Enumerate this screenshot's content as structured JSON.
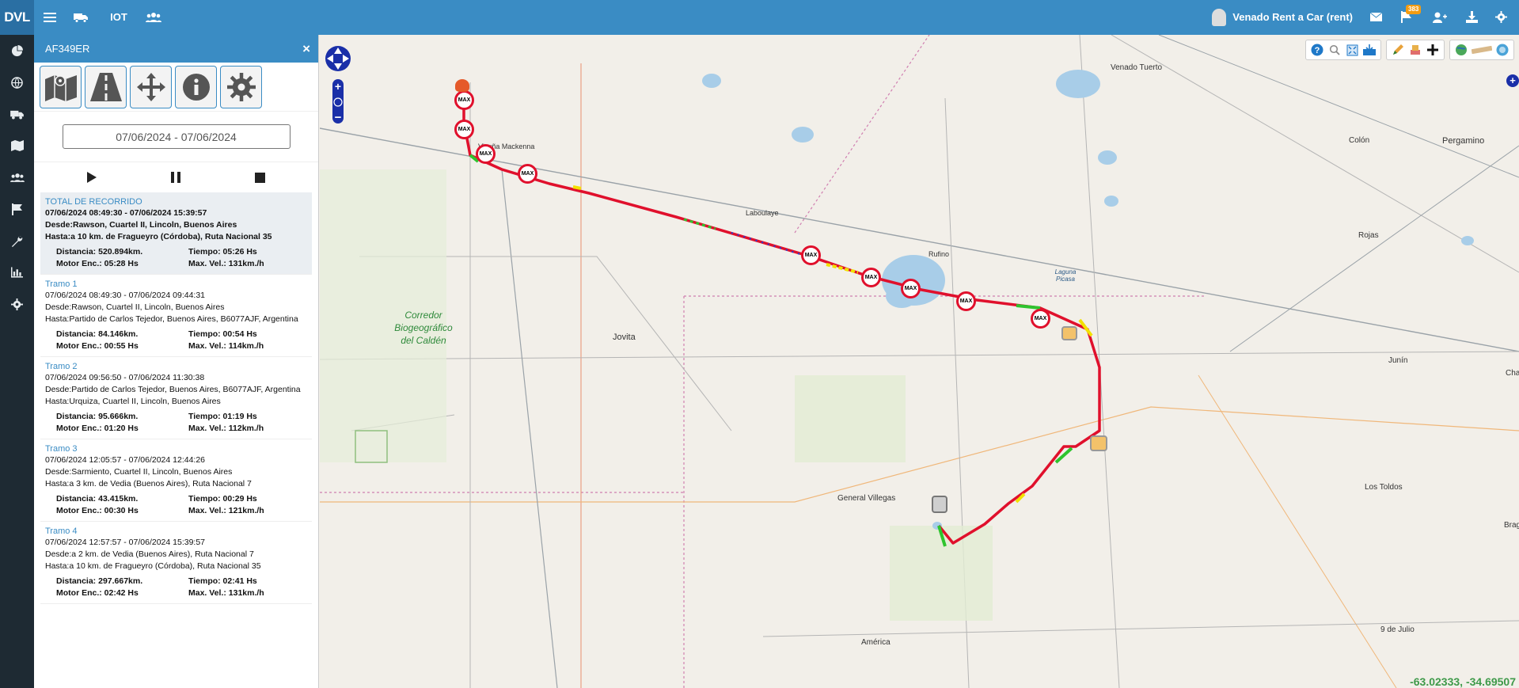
{
  "app": {
    "brand": "DVL",
    "user_name": "Venado Rent a Car (rent)",
    "notifications_count": "383"
  },
  "topbar_icons": [
    "menu-icon",
    "truck-icon",
    "iot-icon",
    "group-icon"
  ],
  "topbar_right_icons": [
    "mail-icon",
    "flag-icon",
    "user-add-icon",
    "download-icon",
    "gear-icon"
  ],
  "topbar_iot_label": "IOT",
  "leftnav": [
    "pie-chart-icon",
    "globe-icon",
    "truck-icon",
    "map-icon",
    "users-icon",
    "flag-icon",
    "wrench-icon",
    "bar-chart-icon",
    "gear-icon"
  ],
  "panel": {
    "title": "AF349ER",
    "close": "×",
    "date_range": "07/06/2024 - 07/06/2024",
    "total": {
      "title": "TOTAL DE RECORRIDO",
      "period": "07/06/2024 08:49:30 - 07/06/2024 15:39:57",
      "desde": "Desde:Rawson, Cuartel II, Lincoln, Buenos Aires",
      "hasta": "Hasta:a 10 km. de Fragueyro (Córdoba), Ruta Nacional 35",
      "distancia": "Distancia: 520.894km.",
      "tiempo": "Tiempo: 05:26 Hs",
      "motor": "Motor Enc.: 05:28 Hs",
      "maxvel": "Max. Vel.: 131km./h"
    },
    "tramos": [
      {
        "title": "Tramo 1",
        "period": "07/06/2024 08:49:30 - 07/06/2024 09:44:31",
        "desde": "Desde:Rawson, Cuartel II, Lincoln, Buenos Aires",
        "hasta": "Hasta:Partido de Carlos Tejedor, Buenos Aires, B6077AJF, Argentina",
        "distancia": "Distancia: 84.146km.",
        "tiempo": "Tiempo: 00:54 Hs",
        "motor": "Motor Enc.: 00:55 Hs",
        "maxvel": "Max. Vel.: 114km./h"
      },
      {
        "title": "Tramo 2",
        "period": "07/06/2024 09:56:50 - 07/06/2024 11:30:38",
        "desde": "Desde:Partido de Carlos Tejedor, Buenos Aires, B6077AJF, Argentina",
        "hasta": "Hasta:Urquiza, Cuartel II, Lincoln, Buenos Aires",
        "distancia": "Distancia: 95.666km.",
        "tiempo": "Tiempo: 01:19 Hs",
        "motor": "Motor Enc.: 01:20 Hs",
        "maxvel": "Max. Vel.: 112km./h"
      },
      {
        "title": "Tramo 3",
        "period": "07/06/2024 12:05:57 - 07/06/2024 12:44:26",
        "desde": "Desde:Sarmiento, Cuartel II, Lincoln, Buenos Aires",
        "hasta": "Hasta:a 3 km. de Vedia (Buenos Aires), Ruta Nacional 7",
        "distancia": "Distancia: 43.415km.",
        "tiempo": "Tiempo: 00:29 Hs",
        "motor": "Motor Enc.: 00:30 Hs",
        "maxvel": "Max. Vel.: 121km./h"
      },
      {
        "title": "Tramo 4",
        "period": "07/06/2024 12:57:57 - 07/06/2024 15:39:57",
        "desde": "Desde:a 2 km. de Vedia (Buenos Aires), Ruta Nacional 7",
        "hasta": "Hasta:a 10 km. de Fragueyro (Córdoba), Ruta Nacional 35",
        "distancia": "Distancia: 297.667km.",
        "tiempo": "Tiempo: 02:41 Hs",
        "motor": "Motor Enc.: 02:42 Hs",
        "maxvel": "Max. Vel.: 131km./h"
      }
    ]
  },
  "map": {
    "coordinates": "-63.02333, -34.69507",
    "speed_marker_label": "MAX",
    "places": [
      "Venado Tuerto",
      "Colón",
      "Pergamino",
      "Rojas",
      "Junín",
      "Chac",
      "Los Toldos",
      "Brag",
      "9 de Julio",
      "América",
      "General Villegas",
      "Jovita",
      "Vicuña Mackenna",
      "Laboulaye",
      "Rufino",
      "Laguna Picasa"
    ],
    "park_label": [
      "Corredor",
      "Biogeográfico",
      "del Caldén"
    ],
    "colors": {
      "route_primary": "#e0102c",
      "route_secondary": "#1e3fd6",
      "route_ok": "#2ec42e",
      "route_mid": "#f2e100",
      "park_text": "#2f8a3b"
    }
  }
}
